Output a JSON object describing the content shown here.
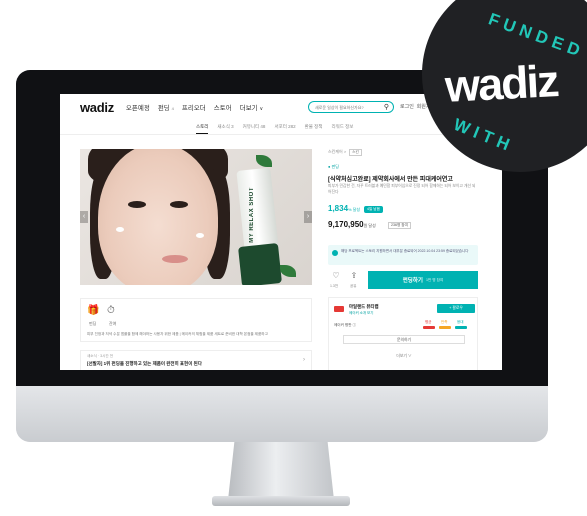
{
  "badge": {
    "top_text": "FUNDED",
    "brand": "wadiz",
    "bottom_text": "WITH",
    "bg_color": "#202124",
    "accent_color": "#22c7b8"
  },
  "nav": {
    "logo": "wadiz",
    "items": [
      "오픈예정",
      "펀딩",
      "프리오더",
      "스토어",
      "더보기"
    ],
    "funding_badge": "4",
    "more_chevron": "chevron-down-icon",
    "search_placeholder": "새로운 일상이 필요하신가요?",
    "right_links": [
      "로그인",
      "회원가입"
    ]
  },
  "subtabs": [
    "스토리",
    "새소식 3",
    "커뮤니티 48",
    "서포터 282",
    "환불 정책",
    "리워드 정보"
  ],
  "photo": {
    "product_label": "MY RELAX SHOT"
  },
  "info_box": {
    "icons": [
      {
        "icon": "gift-icon",
        "label": "펀딩"
      },
      {
        "icon": "clock-icon",
        "label": "잔여"
      }
    ],
    "description": "피부 진정과 저녁 수분 앰플을 함께 해야하는 사용자 위한 제품 | 메이커의 체험을 제품 세트로 준비한 대학 본점을 제품하고"
  },
  "notice": {
    "meta": "새소식 · 3시간 전",
    "title": "[선발자] 1위 펀딩을 진행하고 있는 제품이 완전히 표현이 된다"
  },
  "panel": {
    "breadcrumb": "스킨케어 >",
    "breadcrumb_badge": "스킨",
    "category": "● 펀딩",
    "title": "[식약처심고완료] 제약회사에서 만든 피대케어연고",
    "subtitle": "피부가 민감한 건, 자꾸 트러블과 예민함 피부어심으로 진정 되어 함께하는 되어 보이고 개선 되어진다",
    "percent": "1,834",
    "percent_unit": "% 달성",
    "percent_badge": "4일 남음",
    "amount": "9,170,950",
    "amount_unit": "원 달성",
    "amount_badge": "236명 참여",
    "alert": "해당 프로젝트는 스토리 지원하면서 대부분 종료되어 2022.10.04 23:59 종료되었습니다",
    "like_count": "1.3천",
    "share_count": "공유",
    "cta_label": "펀딩하기",
    "cta_sub": "1만 명 참여",
    "maker_name": "마일랜드 뷰티랩",
    "maker_sub": "메이커 소개 보기",
    "follow_label": "+ 팔로우",
    "indicator": "메이커 평판 ⓘ",
    "stats": [
      {
        "label": "평균",
        "color": "#e53935"
      },
      {
        "label": "만족",
        "color": "#f5a623"
      },
      {
        "label": "응대",
        "color": "#00b2b2"
      }
    ],
    "inquiry_label": "문의하기",
    "more_label": "더보기 ∨"
  }
}
